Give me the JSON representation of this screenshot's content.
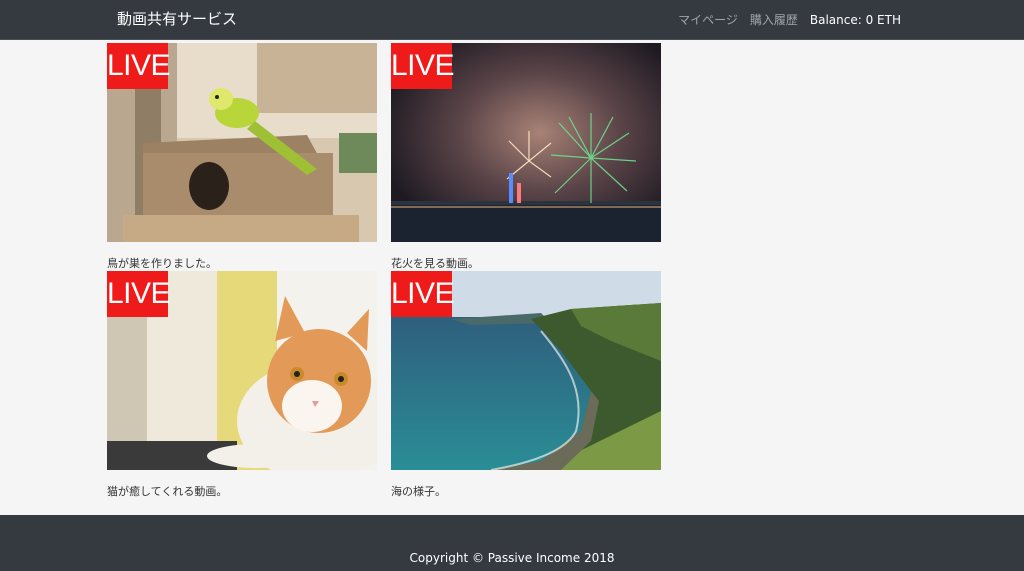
{
  "navbar": {
    "brand": "動画共有サービス",
    "links": [
      {
        "label": "マイページ"
      },
      {
        "label": "購入履歴"
      }
    ],
    "balance": "Balance: 0 ETH"
  },
  "videos": [
    {
      "badge": "LIVE",
      "caption": "鳥が巣を作りました。",
      "thumbnail": "budgie-on-birdhouse"
    },
    {
      "badge": "LIVE",
      "caption": "花火を見る動画。",
      "thumbnail": "fireworks-over-sea"
    },
    {
      "badge": "LIVE",
      "caption": "猫が癒してくれる動画。",
      "thumbnail": "orange-white-cat"
    },
    {
      "badge": "LIVE",
      "caption": "海の様子。",
      "thumbnail": "coastal-cliff"
    }
  ],
  "footer": {
    "copyright": "Copyright © Passive Income 2018"
  },
  "colors": {
    "navbar": "#343a40",
    "live_badge": "#ef1b1b",
    "background": "#f4f5f4"
  }
}
